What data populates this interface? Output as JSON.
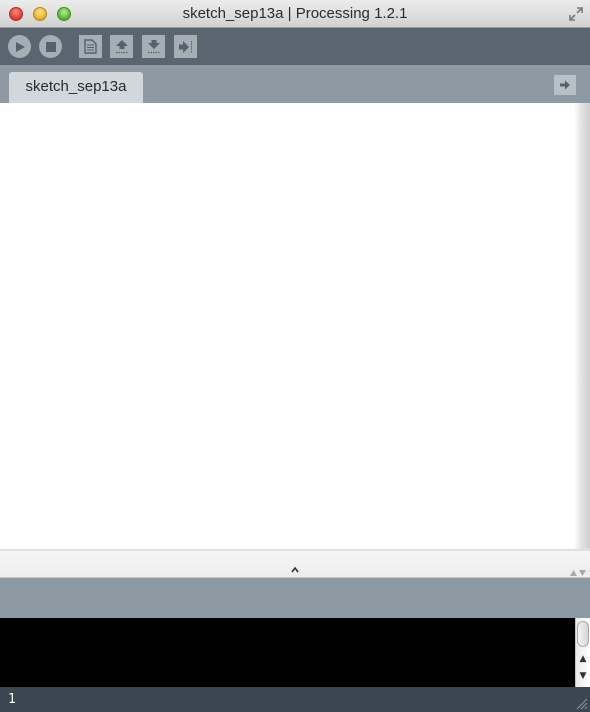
{
  "window": {
    "title": "sketch_sep13a | Processing 1.2.1"
  },
  "toolbar": {
    "buttons": [
      {
        "name": "run-button",
        "icon": "play-icon"
      },
      {
        "name": "stop-button",
        "icon": "stop-icon"
      },
      {
        "name": "new-button",
        "icon": "new-file-icon"
      },
      {
        "name": "open-button",
        "icon": "open-arrow-up-icon"
      },
      {
        "name": "save-button",
        "icon": "save-arrow-down-icon"
      },
      {
        "name": "export-button",
        "icon": "export-arrow-right-icon"
      }
    ]
  },
  "tabs": [
    {
      "label": "sketch_sep13a",
      "active": true
    }
  ],
  "tab_menu_icon": "arrow-right-icon",
  "editor": {
    "content": ""
  },
  "console": {
    "content": ""
  },
  "status": {
    "line_number": "1"
  },
  "colors": {
    "toolbar": "#596570",
    "tabbar": "#8d9aa3",
    "statusbar": "#3a4651",
    "console": "#000000"
  }
}
